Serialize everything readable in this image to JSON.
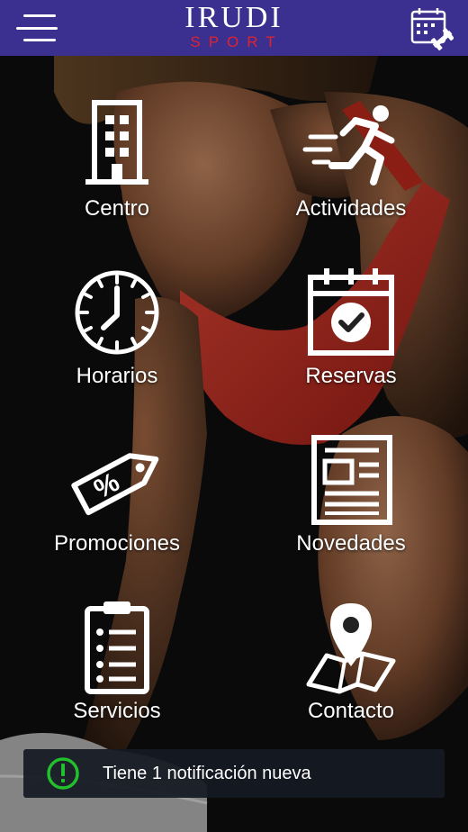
{
  "header": {
    "logo_main": "IRUDI",
    "logo_sub": "SPORT",
    "menu_icon": "hamburger-menu-icon",
    "calendar_icon": "calendar-fitness-icon"
  },
  "colors": {
    "header_bg": "#3b2f8f",
    "logo_accent": "#e0242f",
    "notification_icon": "#22c02c"
  },
  "menu": {
    "centro": {
      "label": "Centro",
      "icon": "building-icon"
    },
    "actividades": {
      "label": "Actividades",
      "icon": "running-man-icon"
    },
    "horarios": {
      "label": "Horarios",
      "icon": "clock-icon"
    },
    "reservas": {
      "label": "Reservas",
      "icon": "calendar-check-icon"
    },
    "promociones": {
      "label": "Promociones",
      "icon": "discount-tag-icon"
    },
    "novedades": {
      "label": "Novedades",
      "icon": "newspaper-icon"
    },
    "servicios": {
      "label": "Servicios",
      "icon": "clipboard-list-icon"
    },
    "contacto": {
      "label": "Contacto",
      "icon": "map-pin-icon"
    }
  },
  "notification": {
    "text": "Tiene 1 notificación nueva",
    "icon": "exclamation-circle-icon"
  }
}
